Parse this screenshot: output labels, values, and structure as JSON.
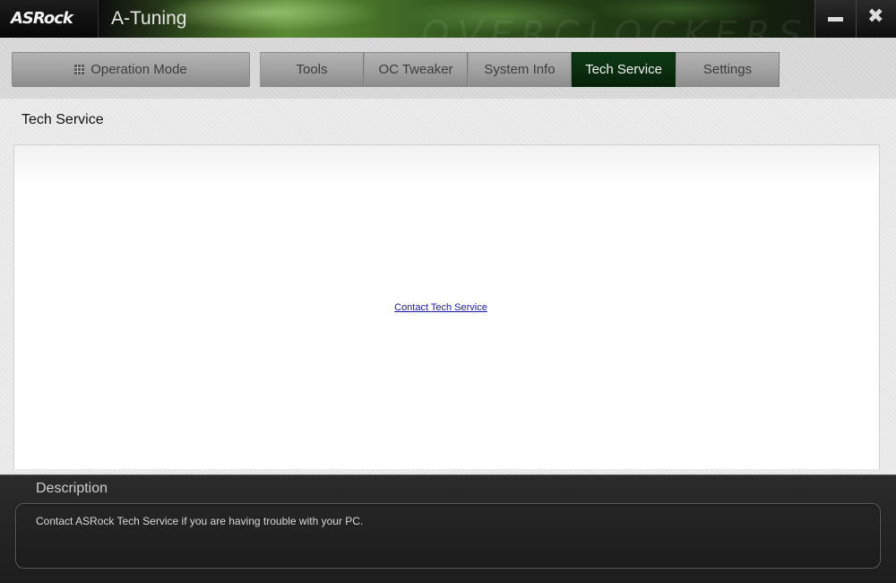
{
  "app": {
    "logo": "ASRock",
    "title": "A-Tuning",
    "watermark": "OVERCLOCKERS.UA"
  },
  "window_controls": {
    "minimize_icon": "minimize-icon",
    "close_icon": "close-icon",
    "close_glyph": "✖"
  },
  "nav": {
    "operation_mode": {
      "label": "Operation Mode",
      "icon": "grid-icon"
    },
    "tabs": [
      {
        "label": "Tools",
        "active": false
      },
      {
        "label": "OC Tweaker",
        "active": false
      },
      {
        "label": "System Info",
        "active": false
      },
      {
        "label": "Tech Service",
        "active": true
      },
      {
        "label": "Settings",
        "active": false
      }
    ]
  },
  "main": {
    "section_title": "Tech Service",
    "link_text": "Contact Tech Service"
  },
  "description": {
    "title": "Description",
    "text": "Contact ASRock Tech Service if you are having trouble with your PC."
  },
  "colors": {
    "active_tab": "#0a2e10",
    "link": "#1a1aa8",
    "description_bg": "#1d1d1d"
  }
}
